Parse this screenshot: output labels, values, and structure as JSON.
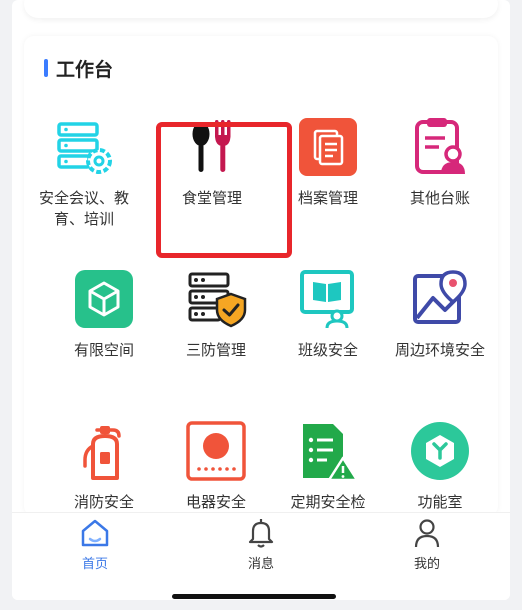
{
  "section": {
    "title": "工作台"
  },
  "grid": [
    {
      "label": "安全会议、教育、培训",
      "icon": "server-gear-icon"
    },
    {
      "label": "食堂管理",
      "icon": "spoon-fork-icon"
    },
    {
      "label": "档案管理",
      "icon": "document-icon"
    },
    {
      "label": "其他台账",
      "icon": "clipboard-user-icon"
    },
    {
      "label": "有限空间",
      "icon": "cube-icon"
    },
    {
      "label": "三防管理",
      "icon": "rack-shield-icon"
    },
    {
      "label": "班级安全",
      "icon": "book-monitor-icon"
    },
    {
      "label": "周边环境安全",
      "icon": "map-pin-icon"
    },
    {
      "label": "消防安全",
      "icon": "fire-extinguisher-icon"
    },
    {
      "label": "电器安全",
      "icon": "appliance-icon"
    },
    {
      "label": "定期安全检",
      "icon": "checklist-warning-icon"
    },
    {
      "label": "功能室",
      "icon": "hexagon-icon"
    }
  ],
  "tabs": [
    {
      "label": "首页",
      "icon": "home-icon",
      "active": true
    },
    {
      "label": "消息",
      "icon": "bell-icon",
      "active": false
    },
    {
      "label": "我的",
      "icon": "user-icon",
      "active": false
    }
  ],
  "colors": {
    "accent": "#3b7cff",
    "highlight": "#e8262b",
    "cyan": "#22d3e6",
    "red": "#f0543a",
    "magenta": "#d6287a",
    "green": "#27c18b",
    "navy": "#3f4aa8"
  }
}
